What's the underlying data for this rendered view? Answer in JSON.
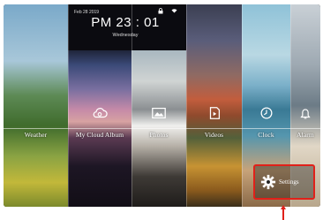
{
  "status": {
    "date": "Feb 28 2019",
    "time": "PM 23 : 01",
    "day": "Wednesday"
  },
  "tiles": [
    {
      "label": "Weather",
      "icon": "weather-icon"
    },
    {
      "label": "My Cloud Album",
      "icon": "cloud-album-icon"
    },
    {
      "label": "Photos",
      "icon": "photos-icon"
    },
    {
      "label": "Videos",
      "icon": "videos-icon"
    },
    {
      "label": "Clock",
      "icon": "clock-icon"
    },
    {
      "label": "Alarm",
      "icon": "alarm-icon"
    }
  ],
  "settings": {
    "label": "Settings",
    "icon": "gear-icon"
  },
  "colors": {
    "highlight": "#e0211a",
    "text": "#ffffff"
  }
}
